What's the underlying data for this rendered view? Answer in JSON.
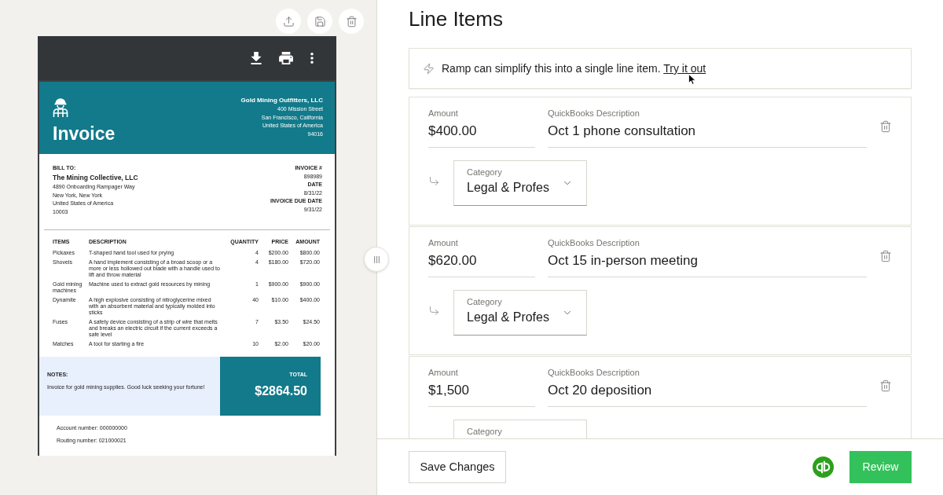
{
  "invoice": {
    "title": "Invoice",
    "vendor": {
      "name": "Gold Mining Outfitters, LLC",
      "address_lines": [
        "400 Mission Street",
        "San Francisco, California",
        "United States of America",
        "94016"
      ]
    },
    "bill_to": {
      "label": "BILL TO:",
      "name": "The Mining Collective, LLC",
      "address_lines": [
        "4890 Onboarding Rampager Way",
        "New York, New York",
        "United States of America",
        "10003"
      ]
    },
    "meta": [
      {
        "label": "INVOICE #",
        "value": "898989"
      },
      {
        "label": "DATE",
        "value": "8/31/22"
      },
      {
        "label": "INVOICE DUE DATE",
        "value": "9/31/22"
      }
    ],
    "table": {
      "columns": [
        "ITEMS",
        "DESCRIPTION",
        "QUANTITY",
        "PRICE",
        "AMOUNT"
      ],
      "rows": [
        {
          "item": "Pickaxes",
          "description": "T-shaped hand tool used for prying",
          "quantity": "4",
          "price": "$200.00",
          "amount": "$800.00"
        },
        {
          "item": "Shovels",
          "description": "A hand implement consisting of a broad scoop or a more or less hollowed out blade with a handle used to lift and throw material",
          "quantity": "4",
          "price": "$180.00",
          "amount": "$720.00"
        },
        {
          "item": "Gold mining machines",
          "description": "Machine used to extract gold resources by mining",
          "quantity": "1",
          "price": "$900.00",
          "amount": "$900.00"
        },
        {
          "item": "Dynamite",
          "description": "A high explosive consisting of nitroglycerine mixed with an absorbent material and typically molded into sticks",
          "quantity": "40",
          "price": "$10.00",
          "amount": "$400.00"
        },
        {
          "item": "Fuses",
          "description": "A safety device consisting of a strip of wire that melts and breaks an electric circuit if the current exceeds a safe level",
          "quantity": "7",
          "price": "$3.50",
          "amount": "$24.50"
        },
        {
          "item": "Matches",
          "description": "A tool for starting a fire",
          "quantity": "10",
          "price": "$2.00",
          "amount": "$20.00"
        }
      ]
    },
    "notes": {
      "label": "NOTES:",
      "text": "Invoice for gold mining supplies. Good luck seeking your fortune!"
    },
    "total": {
      "label": "TOTAL",
      "value": "$2864.50"
    },
    "payment_lines": [
      "Account number: 000000000",
      "Routing number: 021000021"
    ]
  },
  "line_items": {
    "title": "Line Items",
    "suggestion": {
      "text": "Ramp can simplify this into a single line item.",
      "link": "Try it out"
    },
    "items": [
      {
        "amount_label": "Amount",
        "amount": "$400.00",
        "description_label": "QuickBooks Description",
        "description": "Oct 1 phone consultation",
        "category_label": "Category",
        "category": "Legal & Profes"
      },
      {
        "amount_label": "Amount",
        "amount": "$620.00",
        "description_label": "QuickBooks Description",
        "description": "Oct 15 in-person meeting",
        "category_label": "Category",
        "category": "Legal & Profes"
      },
      {
        "amount_label": "Amount",
        "amount": "$1,500",
        "description_label": "QuickBooks Description",
        "description": "Oct 20 deposition",
        "category_label": "Category"
      }
    ]
  },
  "footer": {
    "save_button": "Save Changes",
    "review_button": "Review"
  }
}
